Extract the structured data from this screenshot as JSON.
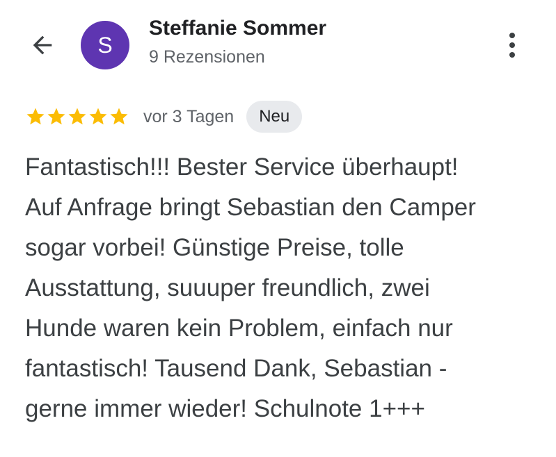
{
  "header": {
    "back_icon": "arrow-back-icon",
    "avatar": {
      "initial": "S",
      "color": "#5e35b1"
    },
    "name": "Steffanie Sommer",
    "reviews_count": "9 Rezensionen",
    "more_icon": "more-vertical-icon"
  },
  "review": {
    "rating": 5,
    "rating_max": 5,
    "star_color": "#fbbc04",
    "date": "vor 3 Tagen",
    "badge": "Neu",
    "lines": [
      "Fantastisch!!! Bester Service überhaupt!",
      "Auf Anfrage bringt Sebastian den Camper",
      "sogar vorbei! Günstige Preise, tolle",
      "Ausstattung, suuuper freundlich, zwei",
      "Hunde waren kein Problem, einfach nur",
      "fantastisch! Tausend Dank, Sebastian -",
      "gerne immer wieder! Schulnote 1+++"
    ]
  }
}
